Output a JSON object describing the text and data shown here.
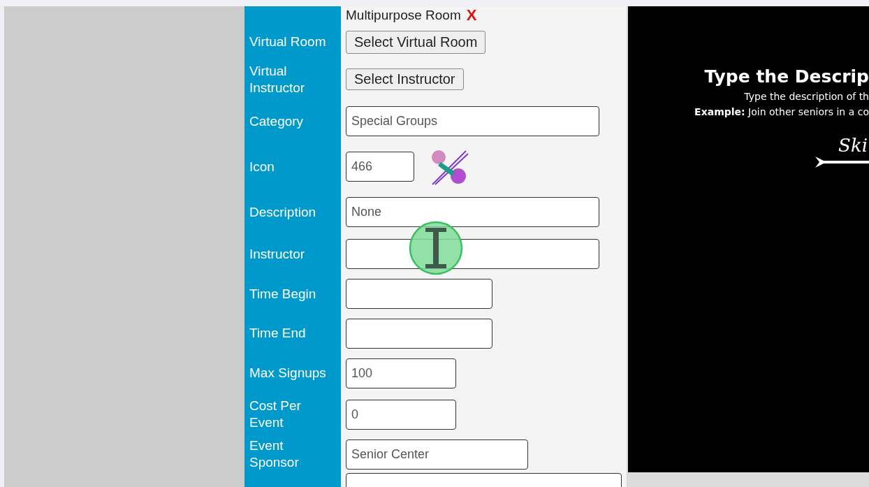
{
  "top_row": {
    "value": "Multipurpose Room",
    "remove": "X"
  },
  "rows": [
    {
      "label": "Virtual Room",
      "kind": "button",
      "text": "Select Virtual Room"
    },
    {
      "label": "Virtual Instructor",
      "kind": "button",
      "text": "Select Instructor"
    },
    {
      "label": "Category",
      "kind": "field",
      "value": "Special Groups"
    },
    {
      "label": "Icon",
      "kind": "icon-field",
      "value": "466"
    },
    {
      "label": "Description",
      "kind": "field",
      "value": "None"
    },
    {
      "label": "Instructor",
      "kind": "field"
    },
    {
      "label": "Time Begin",
      "kind": "field"
    },
    {
      "label": "Time End",
      "kind": "field"
    },
    {
      "label": "Max Signups",
      "kind": "field",
      "value": "100"
    },
    {
      "label": "Cost Per Event",
      "kind": "field",
      "value": "0"
    },
    {
      "label": "Event Sponsor",
      "kind": "field",
      "value": "Senior Center"
    },
    {
      "kind": "field"
    }
  ],
  "panel": {
    "title": "Type the Descrip",
    "subtitle": "Type the description of th",
    "example": "**Example:** Join other seniors in a co",
    "skip": "Ski"
  }
}
